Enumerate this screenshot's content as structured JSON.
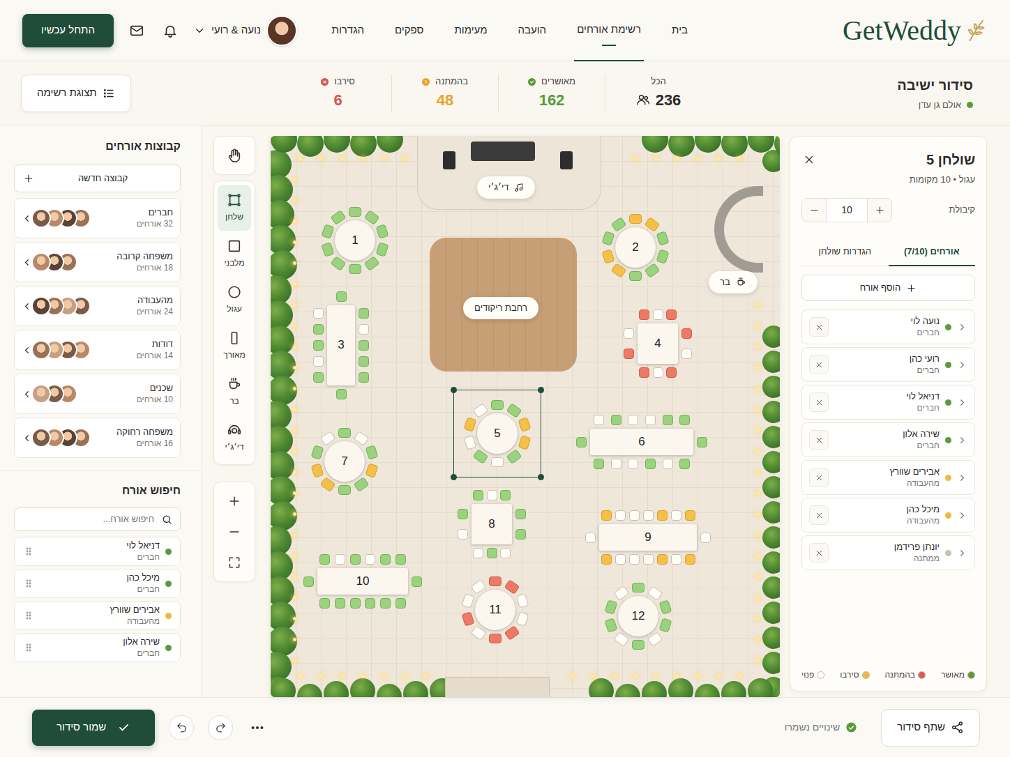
{
  "brand": {
    "name": "GetWeddy"
  },
  "nav": [
    {
      "label": "בית",
      "selected": false
    },
    {
      "label": "רשימת אורחים",
      "selected": true
    },
    {
      "label": "הועבה",
      "selected": false
    },
    {
      "label": "מעימות",
      "selected": false
    },
    {
      "label": "ספקים",
      "selected": false
    },
    {
      "label": "הגדרות",
      "selected": false
    }
  ],
  "user": {
    "name": "נועה & רועי"
  },
  "cta": {
    "label": "התחל עכשיו"
  },
  "page": {
    "title": "סידור ישיבה",
    "venue": "אולם גן עדן"
  },
  "stats": [
    {
      "label": "הכל",
      "value": "236",
      "kind": "total",
      "color": "#2b2b2b"
    },
    {
      "label": "מאושרים",
      "value": "162",
      "kind": "status",
      "color": "#5a9a3c"
    },
    {
      "label": "בהמתנה",
      "value": "48",
      "kind": "status",
      "color": "#e6a52a"
    },
    {
      "label": "סירבו",
      "value": "6",
      "kind": "status",
      "color": "#d9534f"
    }
  ],
  "view_toggle": {
    "label": "תצוגת רשימה"
  },
  "table_panel": {
    "title": "שולחן 5",
    "subtitle": "עגול • 10 מקומות",
    "capacity_label": "קיבולת",
    "capacity": "10",
    "tabs": [
      {
        "label": "אורחים (7/10)",
        "selected": true
      },
      {
        "label": "הגדרות שולחן",
        "selected": false
      }
    ],
    "add_guest": "הוסף אורח",
    "guests": [
      {
        "name": "נועה לוי",
        "group": "חברים",
        "color": "#5a9a3c"
      },
      {
        "name": "רועי כהן",
        "group": "חברים",
        "color": "#5a9a3c"
      },
      {
        "name": "דניאל לוי",
        "group": "חברים",
        "color": "#5a9a3c"
      },
      {
        "name": "שירה אלון",
        "group": "חברים",
        "color": "#5a9a3c"
      },
      {
        "name": "אבירים שוורץ",
        "group": "מהעבודה",
        "color": "#f0b93a"
      },
      {
        "name": "מיכל כהן",
        "group": "מהעבודה",
        "color": "#f0b93a"
      },
      {
        "name": "יונתן פרידמן",
        "group": "ממתנה",
        "color": "#c9c2b4"
      }
    ],
    "legend": [
      {
        "label": "מאושר",
        "color": "#5a9a3c"
      },
      {
        "label": "בהמתנה",
        "color": "#e0584a"
      },
      {
        "label": "סירבו",
        "color": "#f0b93a"
      },
      {
        "label": "פנוי",
        "color": "#ffffff"
      }
    ]
  },
  "toolbar": {
    "pan": {
      "selected": false
    },
    "tools": [
      {
        "label": "שלחן",
        "selected": true
      },
      {
        "label": "מלבני",
        "selected": false
      },
      {
        "label": "עגול",
        "selected": false
      },
      {
        "label": "מאורך",
        "selected": false
      },
      {
        "label": "בר",
        "selected": false
      },
      {
        "label": "די׳ג׳י",
        "selected": false
      }
    ]
  },
  "canvas": {
    "dance_floor": "רחבת ריקודים",
    "dj": "די׳ג׳י",
    "bar": "בר",
    "tables": [
      {
        "number": "1",
        "seats": "gggggggggg",
        "selected": false
      },
      {
        "number": "2",
        "seats": "ooggggoogg",
        "selected": false
      },
      {
        "number": "3",
        "seats": "ggwggggwggwg",
        "selected": false
      },
      {
        "number": "4",
        "seats": "rwrrwrwrwr",
        "selected": false
      },
      {
        "number": "5",
        "seats": "ggoogwgwow",
        "selected": true
      },
      {
        "number": "6",
        "seats": "wgwwggggwwgwgg",
        "selected": false
      },
      {
        "number": "7",
        "seats": "gwgoggoogw",
        "selected": false
      },
      {
        "number": "8",
        "seats": "gwgggwgwgw",
        "selected": false
      },
      {
        "number": "9",
        "seats": "owwwowowowwwowow",
        "selected": false
      },
      {
        "number": "10",
        "seats": "gwgwgggggggggg",
        "selected": false
      },
      {
        "number": "11",
        "seats": "rrwwrrwrww",
        "selected": false
      },
      {
        "number": "12",
        "seats": "gwggwgwggw",
        "selected": false
      }
    ]
  },
  "groups": {
    "title": "קבוצות אורחים",
    "new_group": "קבוצה חדשה",
    "items": [
      {
        "name": "חברים",
        "count": "32 אורחים",
        "avatars": 4
      },
      {
        "name": "משפחה קרובה",
        "count": "18 אורחים",
        "avatars": 3
      },
      {
        "name": "מהעבודה",
        "count": "24 אורחים",
        "avatars": 4
      },
      {
        "name": "דודות",
        "count": "14 אורחים",
        "avatars": 4
      },
      {
        "name": "שכנים",
        "count": "10 אורחים",
        "avatars": 3
      },
      {
        "name": "משפחה רחוקה",
        "count": "16 אורחים",
        "avatars": 4
      }
    ]
  },
  "search": {
    "title": "חיפוש אורח",
    "placeholder": "חיפוש אורח...",
    "results": [
      {
        "name": "דניאל לוי",
        "group": "חברים",
        "color": "#5a9a3c"
      },
      {
        "name": "מיכל כהן",
        "group": "חברים",
        "color": "#5a9a3c"
      },
      {
        "name": "אבירים שוורץ",
        "group": "מהעבודה",
        "color": "#f0b93a"
      },
      {
        "name": "שירה אלון",
        "group": "חברים",
        "color": "#5a9a3c"
      }
    ]
  },
  "footer": {
    "share": "שתף סידור",
    "status": "שינויים נשמרו",
    "save": "שמור סידור"
  }
}
